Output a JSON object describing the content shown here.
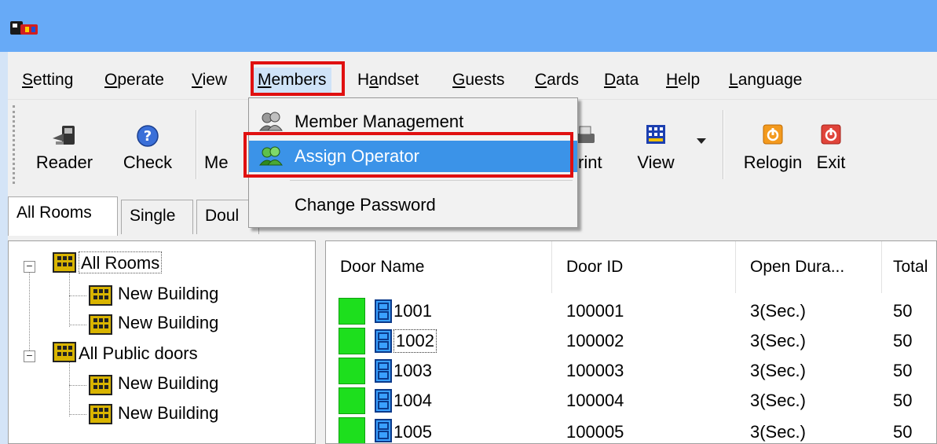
{
  "window": {
    "icon": "app-icon"
  },
  "menubar": {
    "items": [
      {
        "label_u": "S",
        "label_rest": "etting"
      },
      {
        "label_u": "O",
        "label_rest": "perate"
      },
      {
        "label_u": "V",
        "label_rest": "iew"
      },
      {
        "label_u": "M",
        "label_rest": "embers"
      },
      {
        "label_pre": "H",
        "label_u": "a",
        "label_rest": "ndset"
      },
      {
        "label_u": "G",
        "label_rest": "uests"
      },
      {
        "label_u": "C",
        "label_rest": "ards"
      },
      {
        "label_u": "D",
        "label_rest": "ata"
      },
      {
        "label_u": "H",
        "label_rest": "elp"
      },
      {
        "label_u": "L",
        "label_rest": "anguage"
      }
    ],
    "highlighted": "Members"
  },
  "toolbar": {
    "reader": "Reader",
    "check": "Check",
    "members_partial": "Me",
    "print_partial": "rint",
    "view": "View",
    "relogin": "Relogin",
    "exit": "Exit"
  },
  "tabs": [
    "All Rooms",
    "Single",
    "Doul"
  ],
  "tree": {
    "nodes": [
      {
        "label": "All Rooms",
        "level": 0,
        "expanded": true,
        "selected": true
      },
      {
        "label": "New Building",
        "level": 1
      },
      {
        "label": "New Building",
        "level": 1
      },
      {
        "label": "All Public doors",
        "level": 0,
        "expanded": true
      },
      {
        "label": "New Building",
        "level": 1
      },
      {
        "label": "New Building",
        "level": 1
      }
    ]
  },
  "table": {
    "columns": [
      "Door Name",
      "Door ID",
      "Open Dura...",
      "Total"
    ],
    "rows": [
      {
        "name": "1001",
        "id": "100001",
        "duration": "3(Sec.)",
        "total": "50"
      },
      {
        "name": "1002",
        "id": "100002",
        "duration": "3(Sec.)",
        "total": "50",
        "focused": true
      },
      {
        "name": "1003",
        "id": "100003",
        "duration": "3(Sec.)",
        "total": "50"
      },
      {
        "name": "1004",
        "id": "100004",
        "duration": "3(Sec.)",
        "total": "50"
      },
      {
        "name": "1005",
        "id": "100005",
        "duration": "3(Sec.)",
        "total": "50"
      }
    ]
  },
  "dropdown": {
    "items": [
      {
        "label": "Member Management",
        "icon": "members-icon"
      },
      {
        "label": "Assign Operator",
        "icon": "assign-operator-icon",
        "selected": true
      },
      {
        "label": "Change Password",
        "icon": ""
      }
    ]
  },
  "colors": {
    "titlebar": "#67aaf7",
    "highlight_box": "#e01010",
    "menu_selection": "#3b93e8",
    "status_ok": "#1ddf1d"
  }
}
